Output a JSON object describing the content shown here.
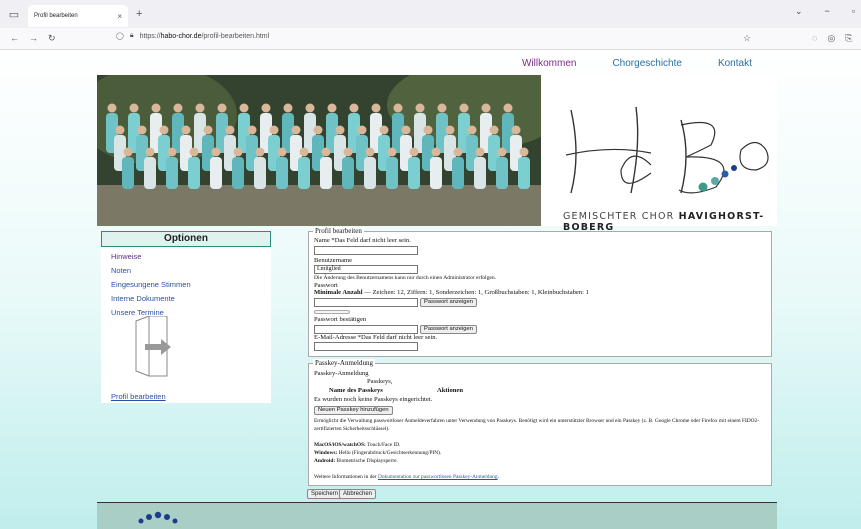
{
  "browser": {
    "tab_title": "Profil bearbeiten",
    "tab_close": "×",
    "new_tab": "+",
    "url_prefix": "https://",
    "url_domain": "habo-chor.de",
    "url_path": "/profil-bearbeiten.html",
    "win_min": "−",
    "win_max": "▫",
    "win_chev": "⌄"
  },
  "topnav": [
    "Willkommen",
    "Chorgeschichte",
    "Kontakt"
  ],
  "logo": {
    "tag_pre": "GEMISCHTER CHOR ",
    "tag_bold": "HAVIGHORST-BOBERG",
    "letters": "HaBo",
    "dot_colors": [
      "#3c9a8c",
      "#5aa9a7",
      "#2a5ca8",
      "#1f3c8c"
    ]
  },
  "sidebar": {
    "title": "Optionen",
    "items": [
      "Hinweise",
      "Noten",
      "Eingesungene Stimmen",
      "Interne Dokumente",
      "Unsere Termine"
    ],
    "profile_link": "Profil bearbeiten"
  },
  "profile": {
    "legend": "Profil bearbeiten",
    "name_label": "Name *Das Feld darf nicht leer sein.",
    "username_label": "Benutzername",
    "username_value": "Lmitglied",
    "username_note": "Die Änderung des Benutzernamens kann nur durch einen Administrator erfolgen.",
    "password_label": "Passwort",
    "pw_rule_bold": "Minimale Anzahl",
    "pw_rule": " — Zeichen: 12, Ziffern: 1, Sonderzeichen: 1, Großbuchstaben: 1, Kleinbuchstaben: 1",
    "show_password": "Passwort anzeigen",
    "confirm_label": "Passwort bestätigen",
    "email_label": "E-Mail-Adresse *Das Feld darf nicht leer sein."
  },
  "passkey": {
    "legend": "Passkey-Anmeldung",
    "heading": "Passkey-Anmeldung",
    "subheading": "Passkeys,",
    "col_name": "Name des Passkeys",
    "col_actions": "Aktionen",
    "empty": "Es wurden noch keine Passkeys eingerichtet.",
    "add_button": "Neuen Passkey hinzufügen",
    "desc": "Ermöglicht die Verwaltung passwortloser Anmeldeverfahren unter Verwendung von Passkeys. Benötigt wird ein unterstützter Browser und ein Passkey (z. B. Google Chrome oder Firefox mit einem FIDO2-zertifizierten Sicherheitsschlüssel).",
    "mac_bold": "MacOS/iOS/watchOS:",
    "mac": " Touch/Face ID.",
    "win_bold": "Windows:",
    "win": " Hello (Fingerabdruck/Gesichtserkennung/PIN).",
    "android_bold": "Android:",
    "android": " Biometrische Displaysperre.",
    "more_pre": "Weitere Informationen in der ",
    "more_link": "Dokumentation zur passwortlosen Passkey-Anmeldung",
    "more_post": "."
  },
  "actions": {
    "save": "Speichern",
    "cancel": "Abbrechen"
  }
}
